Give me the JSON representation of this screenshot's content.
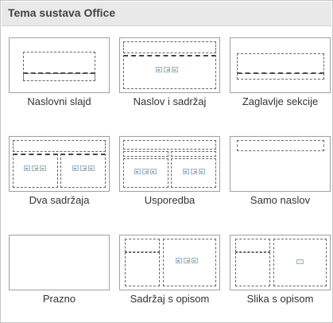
{
  "header": {
    "title": "Tema sustava Office"
  },
  "layouts": [
    {
      "label": "Naslovni slajd"
    },
    {
      "label": "Naslov i sadržaj"
    },
    {
      "label": "Zaglavlje sekcije"
    },
    {
      "label": "Dva sadržaja"
    },
    {
      "label": "Usporedba"
    },
    {
      "label": "Samo naslov"
    },
    {
      "label": "Prazno"
    },
    {
      "label": "Sadržaj s opisom"
    },
    {
      "label": "Slika s opisom"
    }
  ]
}
